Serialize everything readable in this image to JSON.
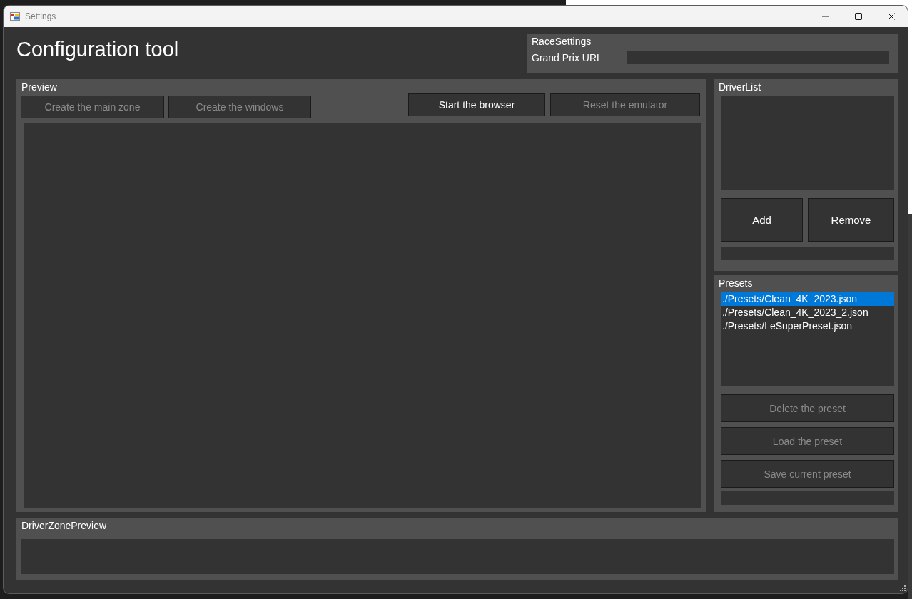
{
  "window": {
    "title": "Settings",
    "heading": "Configuration tool"
  },
  "race_settings": {
    "title": "RaceSettings",
    "fields": [
      {
        "label": "Grand Prix URL"
      }
    ]
  },
  "preview": {
    "title": "Preview",
    "left_buttons": [
      {
        "label": "Create the main zone",
        "disabled": true
      },
      {
        "label": "Create the windows",
        "disabled": true
      }
    ],
    "right_buttons": [
      {
        "label": "Start the browser",
        "disabled": false
      },
      {
        "label": "Reset the emulator",
        "disabled": true
      }
    ]
  },
  "driver_list": {
    "title": "DriverList",
    "buttons": [
      {
        "label": "Add",
        "disabled": false
      },
      {
        "label": "Remove",
        "disabled": false
      }
    ]
  },
  "presets": {
    "title": "Presets",
    "items": [
      {
        "label": "./Presets/Clean_4K_2023.json",
        "selected": true
      },
      {
        "label": "./Presets/Clean_4K_2023_2.json",
        "selected": false
      },
      {
        "label": "./Presets/LeSuperPreset.json",
        "selected": false
      }
    ],
    "buttons": [
      {
        "label": "Delete the preset",
        "disabled": true
      },
      {
        "label": "Load the preset",
        "disabled": true
      },
      {
        "label": "Save current preset",
        "disabled": true
      }
    ]
  },
  "driver_zone_preview": {
    "title": "DriverZonePreview"
  }
}
